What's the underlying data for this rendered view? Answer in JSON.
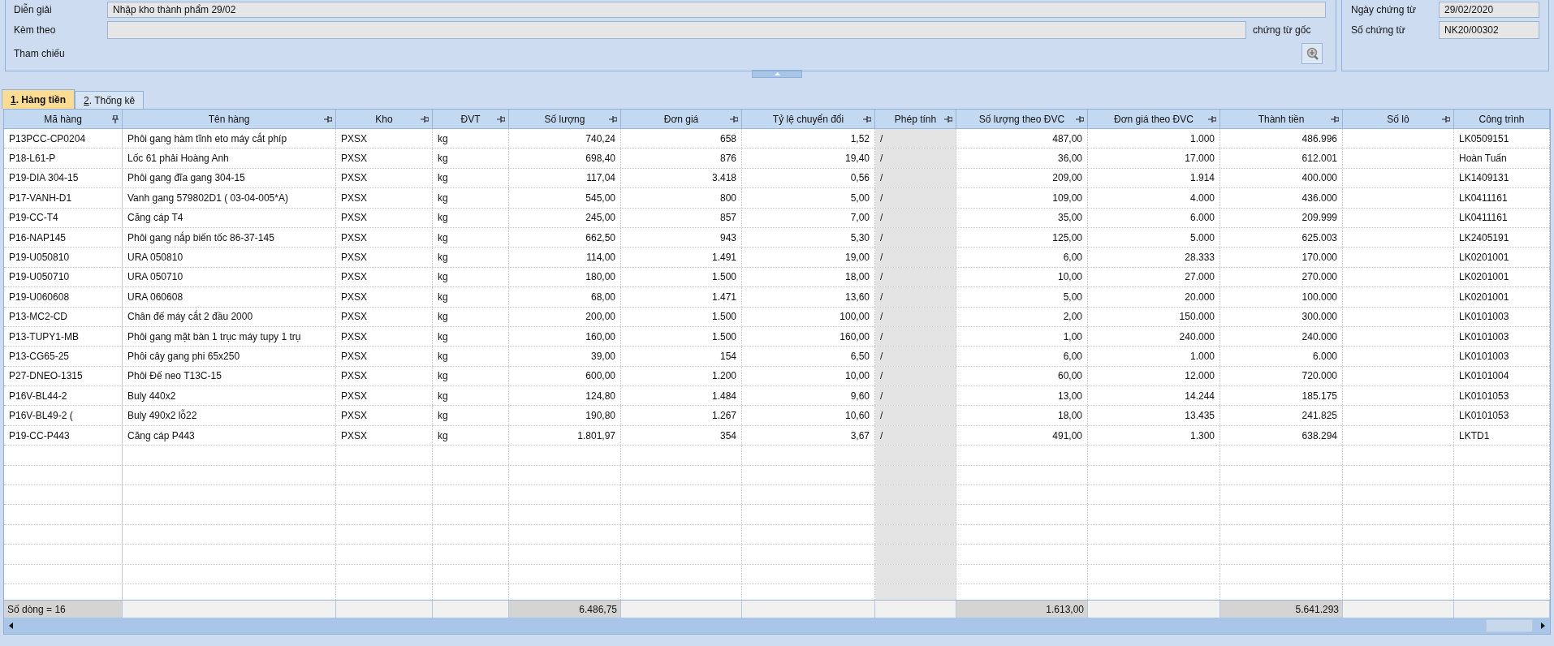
{
  "form": {
    "description": {
      "label": "Diễn giải",
      "value": "Nhập kho thành phẩm 29/02"
    },
    "attachment": {
      "label": "Kèm theo",
      "suffix": "chứng từ gốc"
    },
    "reference": {
      "label": "Tham chiếu"
    },
    "voucher_date": {
      "label": "Ngày chứng từ",
      "value": "29/02/2020"
    },
    "voucher_no": {
      "label": "Số chứng từ",
      "value": "NK20/00302"
    }
  },
  "tabs": [
    {
      "label": "1. Hàng tiền",
      "selected": true
    },
    {
      "label": "2. Thống kê",
      "selected": false
    }
  ],
  "table": {
    "columns": [
      {
        "label": "Mã hàng",
        "kind": "text",
        "pinnable": true
      },
      {
        "label": "Tên hàng",
        "kind": "text",
        "pinnable": true
      },
      {
        "label": "Kho",
        "kind": "text",
        "pinnable": true
      },
      {
        "label": "ĐVT",
        "kind": "text",
        "pinnable": true
      },
      {
        "label": "Số lượng",
        "kind": "number",
        "pinnable": true,
        "total": "6.486,75"
      },
      {
        "label": "Đơn giá",
        "kind": "number",
        "pinnable": true
      },
      {
        "label": "Tỷ lệ chuyển đổi",
        "kind": "number",
        "pinnable": true
      },
      {
        "label": "Phép tính",
        "kind": "operator",
        "pinnable": true
      },
      {
        "label": "Số lượng theo ĐVC",
        "kind": "number",
        "pinnable": true,
        "total": "1.613,00"
      },
      {
        "label": "Đơn giá theo ĐVC",
        "kind": "number",
        "pinnable": true
      },
      {
        "label": "Thành tiền",
        "kind": "number",
        "pinnable": true,
        "total": "5.641.293"
      },
      {
        "label": "Số lô",
        "kind": "text",
        "pinnable": true
      },
      {
        "label": "Công trình",
        "kind": "text",
        "pinnable": false
      }
    ],
    "rows": [
      [
        "P13PCC-CP0204",
        "Phôi gang hàm tĩnh eto máy cắt phíp",
        "PXSX",
        "kg",
        "740,24",
        "658",
        "1,52",
        "/",
        "487,00",
        "1.000",
        "486.996",
        null,
        "LK0509151"
      ],
      [
        "P18-L61-P",
        "Lốc 61 phải Hoàng Anh",
        "PXSX",
        "kg",
        "698,40",
        "876",
        "19,40",
        "/",
        "36,00",
        "17.000",
        "612.001",
        null,
        "Hoàn Tuấn"
      ],
      [
        "P19-DIA 304-15",
        "Phôi gang đĩa gang 304-15",
        "PXSX",
        "kg",
        "117,04",
        "3.418",
        "0,56",
        "/",
        "209,00",
        "1.914",
        "400.000",
        null,
        "LK1409131"
      ],
      [
        "P17-VANH-D1",
        "Vanh gang 579802D1 ( 03-04-005*A)",
        "PXSX",
        "kg",
        "545,00",
        "800",
        "5,00",
        "/",
        "109,00",
        "4.000",
        "436.000",
        null,
        "LK0411161"
      ],
      [
        "P19-CC-T4",
        "Căng cáp T4",
        "PXSX",
        "kg",
        "245,00",
        "857",
        "7,00",
        "/",
        "35,00",
        "6.000",
        "209.999",
        null,
        "LK0411161"
      ],
      [
        "P16-NAP145",
        "Phôi gang nắp biến tốc 86-37-145",
        "PXSX",
        "kg",
        "662,50",
        "943",
        "5,30",
        "/",
        "125,00",
        "5.000",
        "625.003",
        null,
        "LK2405191"
      ],
      [
        "P19-U050810",
        "URA 050810",
        "PXSX",
        "kg",
        "114,00",
        "1.491",
        "19,00",
        "/",
        "6,00",
        "28.333",
        "170.000",
        null,
        "LK0201001"
      ],
      [
        "P19-U050710",
        "URA 050710",
        "PXSX",
        "kg",
        "180,00",
        "1.500",
        "18,00",
        "/",
        "10,00",
        "27.000",
        "270.000",
        null,
        "LK0201001"
      ],
      [
        "P19-U060608",
        "URA 060608",
        "PXSX",
        "kg",
        "68,00",
        "1.471",
        "13,60",
        "/",
        "5,00",
        "20.000",
        "100.000",
        null,
        "LK0201001"
      ],
      [
        "P13-MC2-CD",
        "Chân đế máy cắt 2 đầu 2000",
        "PXSX",
        "kg",
        "200,00",
        "1.500",
        "100,00",
        "/",
        "2,00",
        "150.000",
        "300.000",
        null,
        "LK0101003"
      ],
      [
        "P13-TUPY1-MB",
        "Phôi gang mặt bàn 1 trục máy tupy 1 trụ",
        "PXSX",
        "kg",
        "160,00",
        "1.500",
        "160,00",
        "/",
        "1,00",
        "240.000",
        "240.000",
        null,
        "LK0101003"
      ],
      [
        "P13-CG65-25",
        "Phôi cây gang phi 65x250",
        "PXSX",
        "kg",
        "39,00",
        "154",
        "6,50",
        "/",
        "6,00",
        "1.000",
        "6.000",
        null,
        "LK0101003"
      ],
      [
        "P27-DNEO-1315",
        "Phôi Đế neo T13C-15",
        "PXSX",
        "kg",
        "600,00",
        "1.200",
        "10,00",
        "/",
        "60,00",
        "12.000",
        "720.000",
        null,
        "LK0101004"
      ],
      [
        "P16V-BL44-2",
        "Buly 440x2",
        "PXSX",
        "kg",
        "124,80",
        "1.484",
        "9,60",
        "/",
        "13,00",
        "14.244",
        "185.175",
        null,
        "LK0101053"
      ],
      [
        "P16V-BL49-2 (",
        "Buly 490x2 lỗ22",
        "PXSX",
        "kg",
        "190,80",
        "1.267",
        "10,60",
        "/",
        "18,00",
        "13.435",
        "241.825",
        null,
        "LK0101053"
      ],
      [
        "P19-CC-P443",
        "Căng cáp P443",
        "PXSX",
        "kg",
        "1.801,97",
        "354",
        "3,67",
        "/",
        "491,00",
        "1.300",
        "638.294",
        null,
        "LKTD1"
      ]
    ],
    "row_count": "Số dòng = 16"
  }
}
